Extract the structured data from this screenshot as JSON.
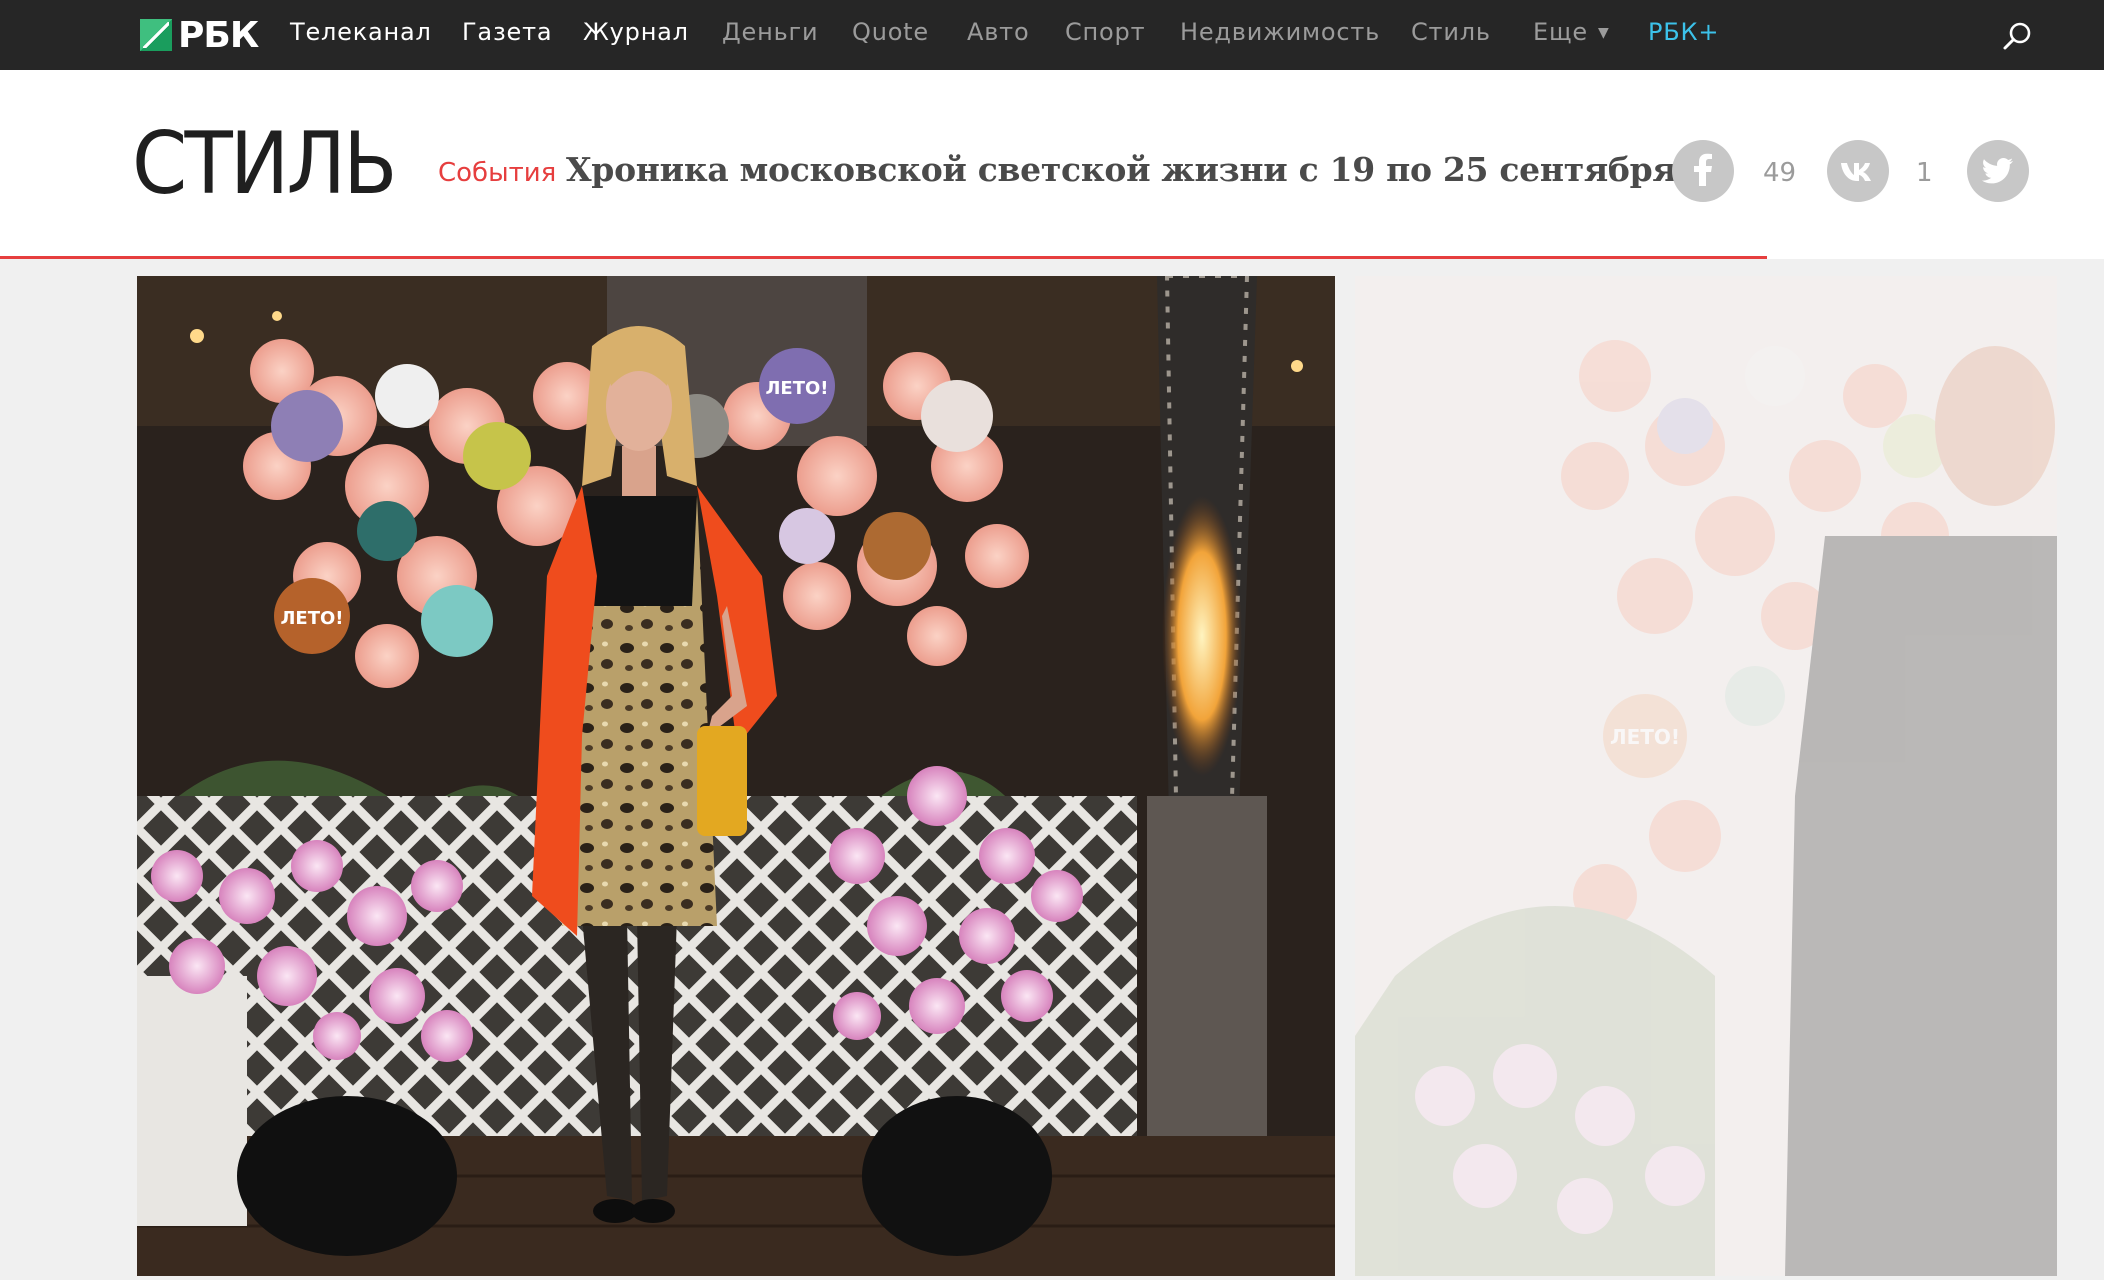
{
  "nav": {
    "logo": "РБК",
    "items": [
      {
        "label": "Телеканал",
        "style": "bright"
      },
      {
        "label": "Газета",
        "style": "bright"
      },
      {
        "label": "Журнал",
        "style": "bright"
      },
      {
        "label": "Деньги",
        "style": "dim"
      },
      {
        "label": "Quote",
        "style": "dim"
      },
      {
        "label": "Авто",
        "style": "dim"
      },
      {
        "label": "Спорт",
        "style": "dim"
      },
      {
        "label": "Недвижимость",
        "style": "dim"
      },
      {
        "label": "Стиль",
        "style": "dim"
      },
      {
        "label": "Еще",
        "style": "dim"
      },
      {
        "label": "РБК+",
        "style": "plus"
      }
    ],
    "search_icon": "search-icon"
  },
  "header": {
    "section_logo": "СТИЛЬ",
    "rubric": "События",
    "headline": "Хроника московской светской жизни с 19 по 25 сентября",
    "share": {
      "facebook": {
        "icon": "facebook-icon",
        "count": "49"
      },
      "vk": {
        "icon": "vk-icon",
        "count": "1"
      },
      "twitter": {
        "icon": "twitter-icon"
      }
    },
    "reading_progress": 0.84
  },
  "gallery": {
    "badge_text": "ЛЕТО!"
  },
  "colors": {
    "nav_bg": "#262626",
    "accent_red": "#e63e3e",
    "plus_blue": "#3cc2ea",
    "share_grey": "#c7c7c7"
  }
}
